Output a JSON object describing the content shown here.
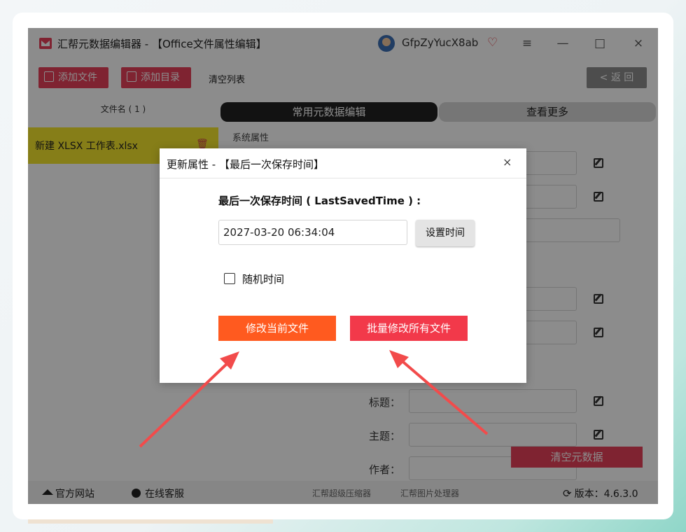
{
  "window": {
    "title": "汇帮元数据编辑器 - 【Office文件属性编辑】",
    "username": "GfpZyYucX8ab",
    "controls": {
      "menu": "≡",
      "minimize": "—",
      "maximize": "□",
      "close": "×"
    }
  },
  "toolbar": {
    "add_file": "添加文件",
    "add_dir": "添加目录",
    "clear_list": "清空列表",
    "back": "< 返 回"
  },
  "left_panel": {
    "header": "文件名 ( 1 )",
    "files": [
      "新建 XLSX 工作表.xlsx"
    ]
  },
  "right_panel": {
    "tabs": [
      "常用元数据编辑",
      "查看更多"
    ],
    "section": "系统属性",
    "fields": [
      {
        "label": "标题："
      },
      {
        "label": "主题："
      },
      {
        "label": "作者："
      }
    ],
    "clear_meta": "清空元数据"
  },
  "dialog": {
    "title": "更新属性 - 【最后一次保存时间】",
    "close": "×",
    "field_label": "最后一次保存时间 ( LastSavedTime ) :",
    "field_value": "2027-03-20 06:34:04",
    "set_time": "设置时间",
    "random_time": "随机时间",
    "modify_current": "修改当前文件",
    "modify_all": "批量修改所有文件"
  },
  "statusbar": {
    "website": "官方网站",
    "support": "在线客服",
    "compressor": "汇帮超级压缩器",
    "image_tool": "汇帮图片处理器",
    "version": "版本：4.6.3.0"
  },
  "colors": {
    "accent": "#e8405a",
    "highlight_row": "#f5e52c",
    "modify_current": "#ff5a1f",
    "modify_all": "#f2394a",
    "annotation_arrow": "#f24b4b"
  }
}
